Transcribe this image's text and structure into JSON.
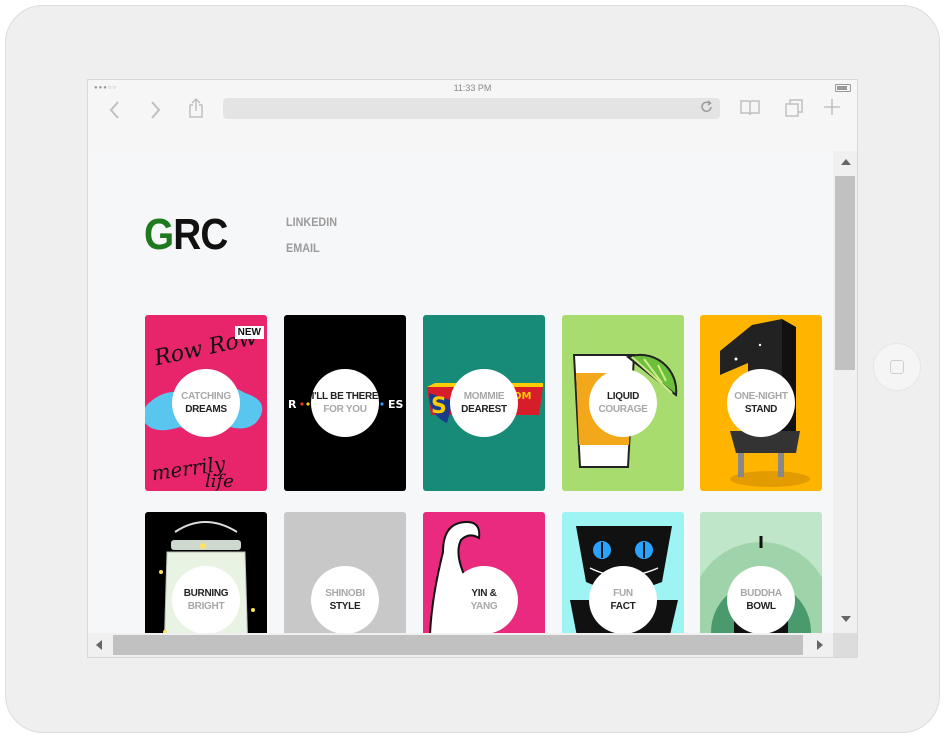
{
  "statusbar": {
    "time": "11:33 PM",
    "signal": "●●●○○"
  },
  "icons": {
    "back": "chevron-left-icon",
    "forward": "chevron-right-icon",
    "share": "share-icon",
    "reload": "reload-icon",
    "bookmarks": "book-icon",
    "tabs": "tabs-icon",
    "new_tab": "plus-icon"
  },
  "site": {
    "logo_first": "G",
    "logo_rest": "RC",
    "logo_accent": "#1f7a1f",
    "links": [
      "LINKEDIN",
      "EMAIL"
    ]
  },
  "cards": [
    {
      "line1": "CATCHING",
      "line2": "DREAMS",
      "badge": "NEW",
      "bg": "#e8246a",
      "art": "catching"
    },
    {
      "line1": "I'LL BE THERE",
      "line2": "FOR YOU",
      "badge": "",
      "bg": "#000000",
      "art": "friends",
      "art_text": "R · · · · E S",
      "dark_first": true
    },
    {
      "line1": "MOMMIE",
      "line2": "DEAREST",
      "badge": "",
      "bg": "#178a78",
      "art": "mommie"
    },
    {
      "line1": "LIQUID",
      "line2": "COURAGE",
      "badge": "",
      "bg": "#a8dc6e",
      "art": "liquid",
      "dark_first": true
    },
    {
      "line1": "ONE-NIGHT",
      "line2": "STAND",
      "badge": "",
      "bg": "#ffb400",
      "art": "onenight"
    },
    {
      "line1": "BURNING",
      "line2": "BRIGHT",
      "badge": "",
      "bg": "#000000",
      "art": "burning",
      "dark_first": true
    },
    {
      "line1": "SHINOBI",
      "line2": "STYLE",
      "badge": "",
      "bg": "#c8c8c8",
      "art": "shinobi"
    },
    {
      "line1": "YIN &",
      "line2": "YANG",
      "badge": "",
      "bg": "#ea2a7e",
      "art": "yinyang",
      "dark_first": true
    },
    {
      "line1": "FUN",
      "line2": "FACT",
      "badge": "",
      "bg": "#9ef3f3",
      "art": "funfact"
    },
    {
      "line1": "BUDDHA",
      "line2": "BOWL",
      "badge": "",
      "bg": "#bfe6c8",
      "art": "buddha"
    }
  ]
}
